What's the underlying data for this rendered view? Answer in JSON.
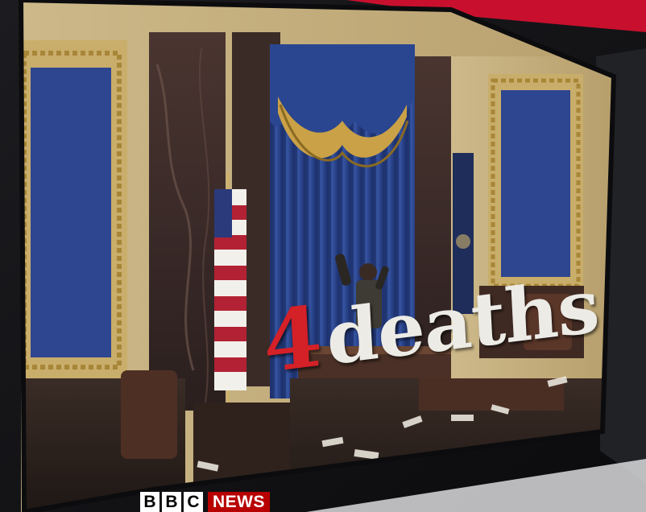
{
  "caption": {
    "number": "4",
    "word": "deaths"
  },
  "broadcaster": {
    "letters": [
      "B",
      "B",
      "C"
    ],
    "news": "NEWS"
  },
  "colors": {
    "accent_red": "#d42027",
    "caption_white": "#ecebe6",
    "news_red": "#b80000",
    "panel_blue": "#2e4590",
    "gold": "#c8a24a"
  }
}
